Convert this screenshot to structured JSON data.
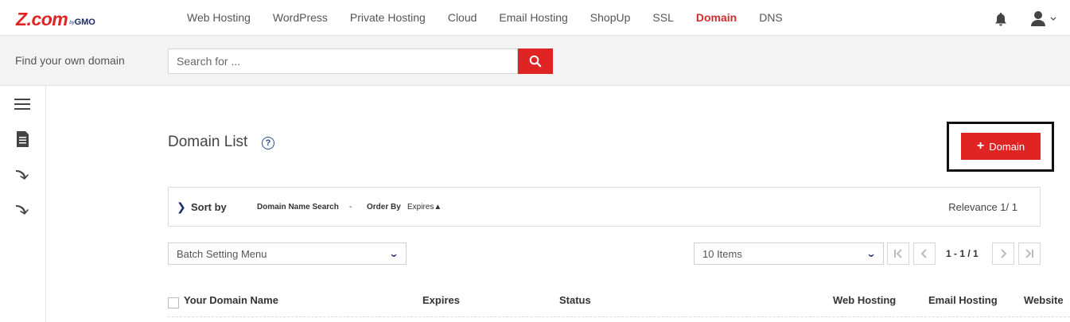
{
  "brand": {
    "logo_main": "Z.com",
    "logo_by": "by",
    "logo_gmo": "GMO"
  },
  "nav": {
    "items": [
      "Web Hosting",
      "WordPress",
      "Private Hosting",
      "Cloud",
      "Email Hosting",
      "ShopUp",
      "SSL",
      "Domain",
      "DNS"
    ],
    "active": "Domain"
  },
  "search": {
    "label": "Find your own domain",
    "placeholder": "Search for ..."
  },
  "main": {
    "title": "Domain List",
    "help": "?",
    "add_button": {
      "icon": "+",
      "label": "Domain"
    }
  },
  "sort": {
    "title": "Sort by",
    "domain_search_label": "Domain Name Search",
    "domain_search_value": "-",
    "order_label": "Order By",
    "order_value": "Expires▲",
    "relevance": "Relevance 1/ 1"
  },
  "batch_menu": {
    "selected": "Batch Setting Menu"
  },
  "items_select": {
    "selected": "10 Items"
  },
  "pagination": {
    "first": "|<",
    "prev": "<",
    "range": "1 - 1 / 1",
    "next": ">",
    "last": ">|"
  },
  "table": {
    "columns": [
      "Your Domain Name",
      "Expires",
      "Status",
      "Web Hosting",
      "Email Hosting",
      "Website"
    ]
  },
  "colors": {
    "brand_red": "#e02424",
    "brand_navy": "#1b2a6b",
    "nav_active": "#d12b2b"
  }
}
